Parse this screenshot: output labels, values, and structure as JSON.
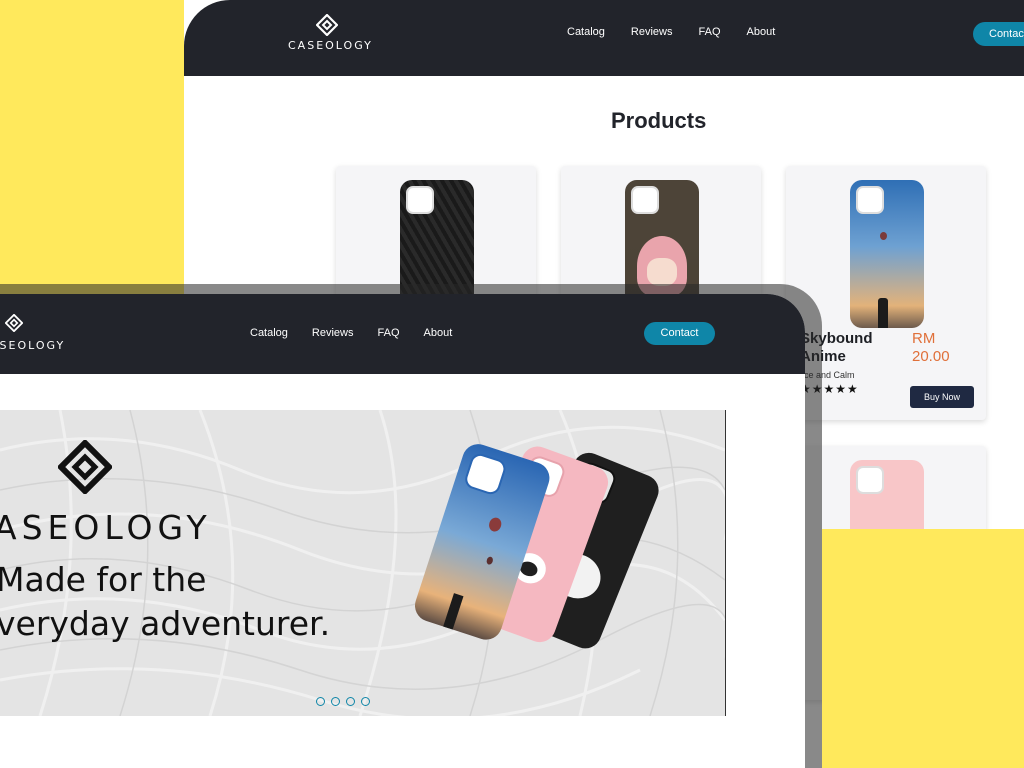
{
  "back": {
    "nav": {
      "brand": "CASEOLOGY",
      "links": [
        "Catalog",
        "Reviews",
        "FAQ",
        "About"
      ],
      "contact": "Contac"
    },
    "products_title": "Products",
    "featured": {
      "name": "Skybound Anime",
      "price": "RM 20.00",
      "description": "lice and Calm",
      "stars": "★★★★★",
      "buy_label": "Buy Now"
    }
  },
  "front": {
    "nav": {
      "brand": "ASEOLOGY",
      "links": [
        "Catalog",
        "Reviews",
        "FAQ",
        "About"
      ],
      "contact": "Contact"
    },
    "hero": {
      "brand": "ASEOLOGY",
      "tagline_line1": "Made for the",
      "tagline_line2": "veryday adventurer."
    }
  },
  "colors": {
    "yellow": "#ffe95c",
    "nav_dark": "#22242b",
    "accent": "#0f86a8",
    "price": "#e0703a",
    "button_dark": "#1f2942"
  }
}
